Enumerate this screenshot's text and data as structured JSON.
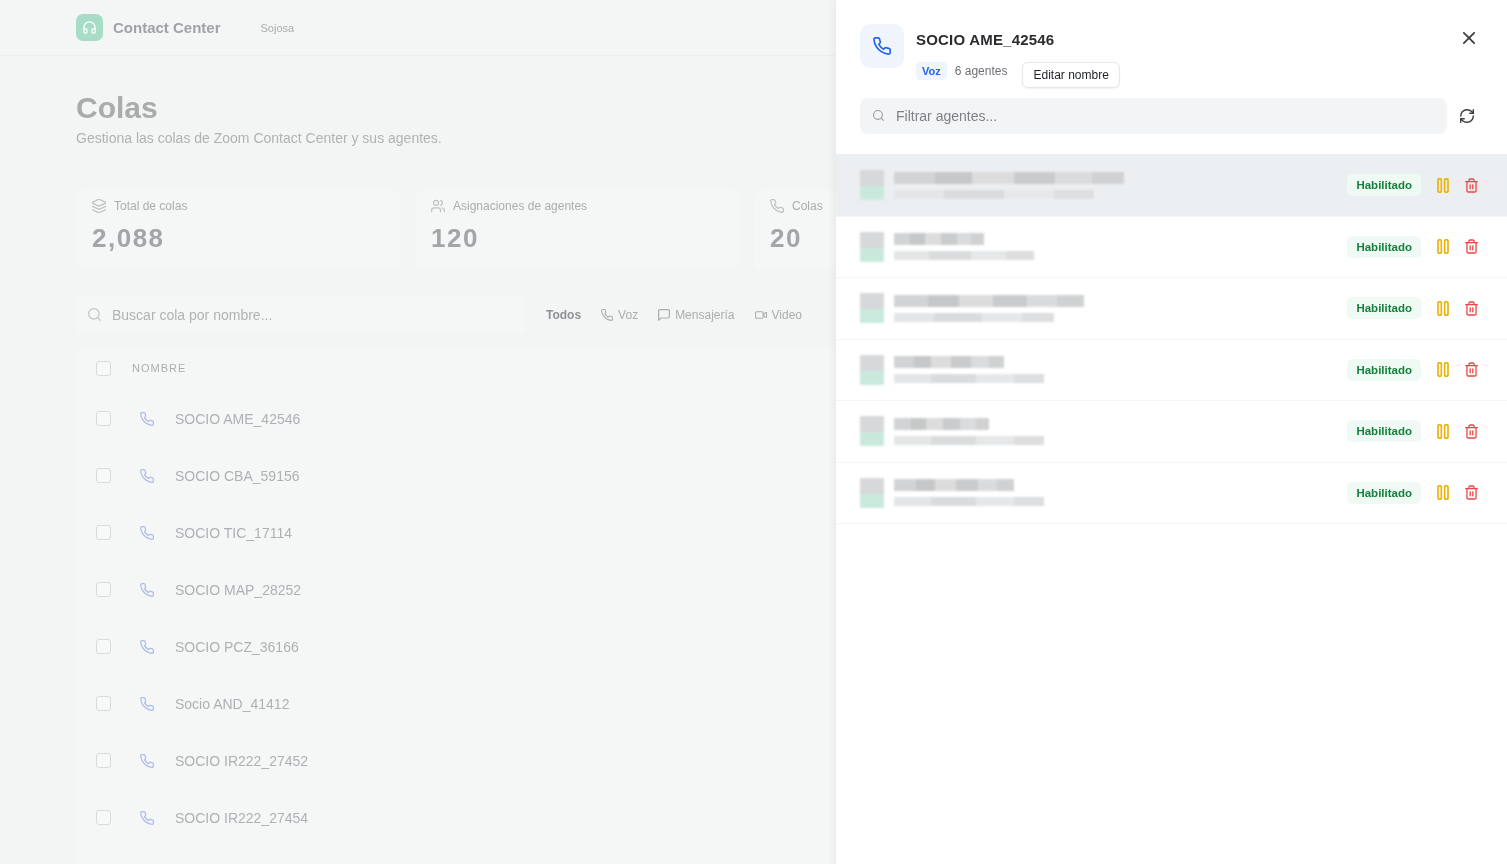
{
  "app": {
    "name": "Contact Center",
    "org": "Sojosa"
  },
  "page": {
    "title": "Colas",
    "subtitle": "Gestiona las colas de Zoom Contact Center y sus agentes."
  },
  "stats": [
    {
      "label": "Total de colas",
      "value": "2,088"
    },
    {
      "label": "Asignaciones de agentes",
      "value": "120"
    },
    {
      "label": "Colas",
      "value": "20"
    }
  ],
  "search": {
    "placeholder": "Buscar cola por nombre..."
  },
  "filters": [
    {
      "label": "Todos",
      "selected": true
    },
    {
      "label": "Voz",
      "selected": false
    },
    {
      "label": "Mensajería",
      "selected": false
    },
    {
      "label": "Video",
      "selected": false
    }
  ],
  "table": {
    "columns": [
      "NOMBRE"
    ],
    "select_all_checked": false,
    "rows": [
      {
        "name": "SOCIO AME_42546",
        "checked": false
      },
      {
        "name": "SOCIO CBA_59156",
        "checked": false
      },
      {
        "name": "SOCIO TIC_17114",
        "checked": false
      },
      {
        "name": "SOCIO MAP_28252",
        "checked": false
      },
      {
        "name": "SOCIO PCZ_36166",
        "checked": false
      },
      {
        "name": "Socio AND_41412",
        "checked": false
      },
      {
        "name": "SOCIO IR222_27452",
        "checked": false
      },
      {
        "name": "SOCIO IR222_27454",
        "checked": false
      }
    ]
  },
  "drawer": {
    "title": "SOCIO AME_42546",
    "channel": "Voz",
    "agent_count": "6 agentes",
    "edit_button": "Editar nombre",
    "filter": {
      "placeholder": "Filtrar agentes..."
    },
    "agents": [
      {
        "status": "Habilitado",
        "enabled": true,
        "highlighted": true
      },
      {
        "status": "Habilitado",
        "enabled": true,
        "highlighted": false
      },
      {
        "status": "Habilitado",
        "enabled": true,
        "highlighted": false
      },
      {
        "status": "Habilitado",
        "enabled": true,
        "highlighted": false
      },
      {
        "status": "Habilitado",
        "enabled": true,
        "highlighted": false
      },
      {
        "status": "Habilitado",
        "enabled": true,
        "highlighted": false
      }
    ]
  }
}
